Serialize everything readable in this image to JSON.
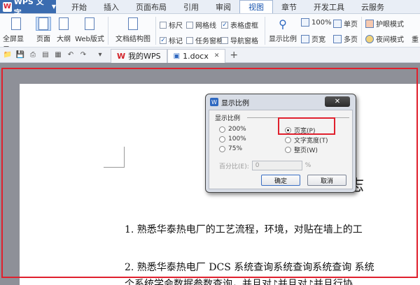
{
  "app": {
    "name": "WPS 文字",
    "logo": "W"
  },
  "menu_tabs": [
    "开始",
    "插入",
    "页面布局",
    "引用",
    "审阅",
    "视图",
    "章节",
    "开发工具",
    "云服务"
  ],
  "active_tab": "视图",
  "ribbon": {
    "full_screen": "全屏显示",
    "page": "页面",
    "outline": "大纲",
    "web_layout": "Web版式",
    "doc_structure": "文档结构图",
    "checkboxes": [
      {
        "label": "标尺",
        "checked": false
      },
      {
        "label": "网格线",
        "checked": false
      },
      {
        "label": "表格虚框",
        "checked": true
      },
      {
        "label": "标记",
        "checked": true
      },
      {
        "label": "任务窗格",
        "checked": false
      },
      {
        "label": "导航窗格",
        "checked": false
      }
    ],
    "zoom_ratio": "显示比例",
    "zoom_100": "100%",
    "page_width": "页宽",
    "single_page": "单页",
    "multi_page": "多页",
    "eye_mode": "护眼模式",
    "night_mode": "夜间模式",
    "cut_label": "重"
  },
  "doc_tabs": [
    {
      "label": "我的WPS"
    },
    {
      "label": "1.docx"
    }
  ],
  "document": {
    "heading_fragment": "志",
    "items": [
      "1.  熟悉华泰热电厂的工艺流程，环境，对贴在墙上的工",
      "2.  熟悉华泰热电厂 DCS 系统查询系统查询系统查询 系统",
      "个系统学会数据参数查询，并且对♪并且对♪并且行协"
    ]
  },
  "dialog": {
    "title": "显示比例",
    "group_label": "显示比例",
    "options_left": [
      "200%",
      "100%",
      "75%"
    ],
    "options_right": [
      "页宽(P)",
      "文字宽度(T)",
      "整页(W)"
    ],
    "selected": "页宽(P)",
    "percent_label": "百分比(E):",
    "percent_value": "0",
    "percent_unit": "%",
    "ok": "确定",
    "cancel": "取消"
  },
  "colors": {
    "highlight": "#e0202d",
    "accent": "#3b6cb0"
  }
}
